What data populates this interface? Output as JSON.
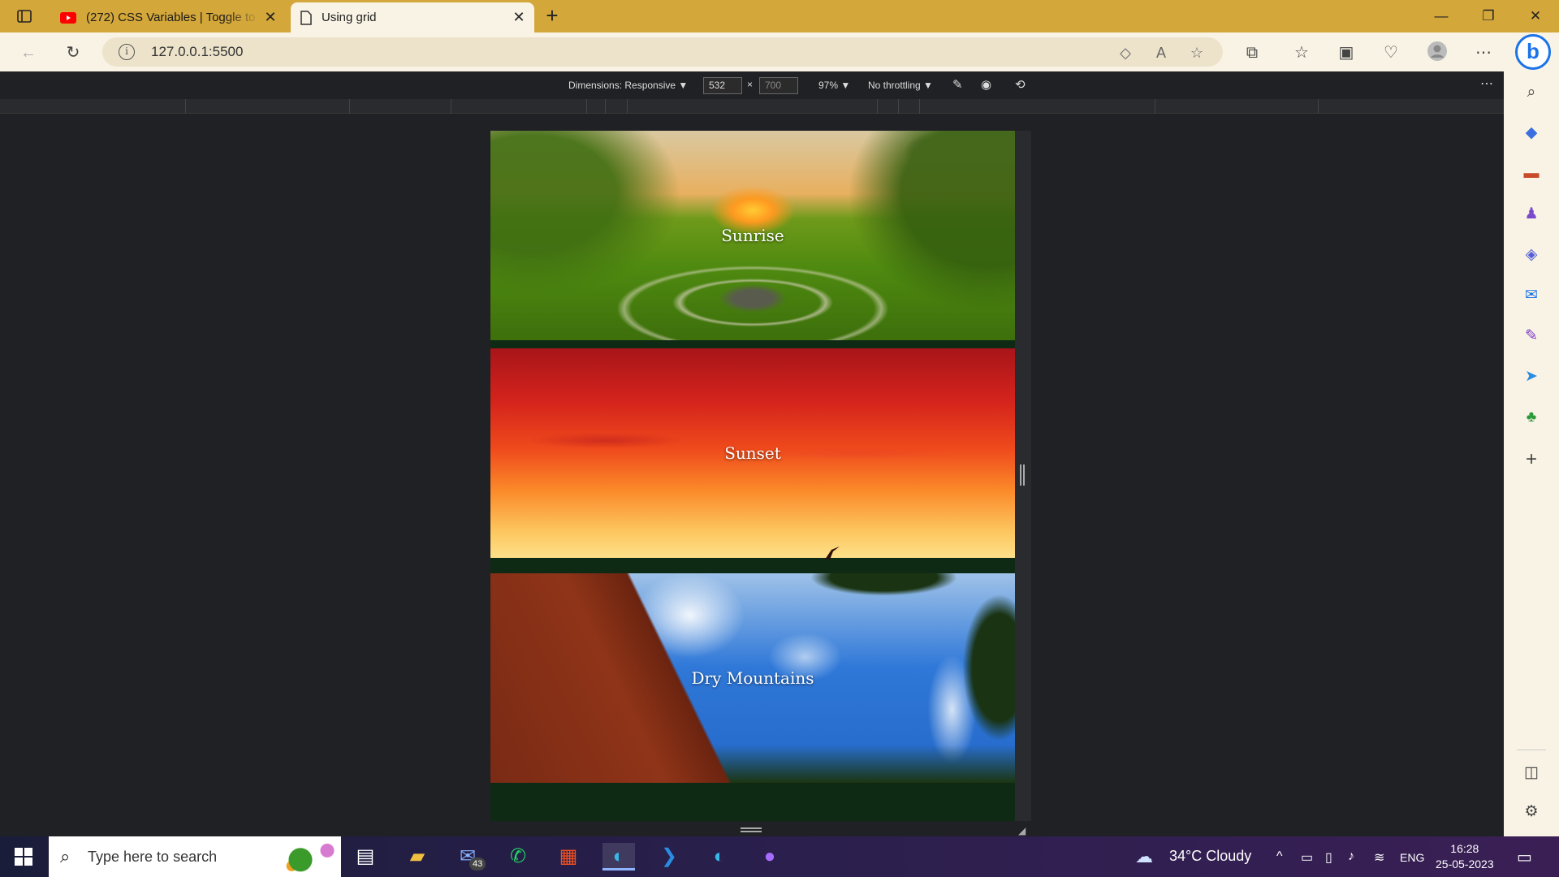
{
  "browser": {
    "tabs": [
      {
        "title": "(272) CSS Variables | Toggle to th",
        "favicon": "youtube-icon",
        "active": false
      },
      {
        "title": "Using grid",
        "favicon": "document-icon",
        "active": true
      }
    ],
    "url": "127.0.0.1:5500"
  },
  "devtools": {
    "dimensions_label": "Dimensions: Responsive",
    "width": "532",
    "height": "700",
    "zoom": "97%",
    "throttling": "No throttling",
    "times": "×"
  },
  "page": {
    "cards": [
      {
        "label": "Sunrise"
      },
      {
        "label": "Sunset"
      },
      {
        "label": "Dry Mountains"
      }
    ]
  },
  "taskbar": {
    "search_placeholder": "Type here to search",
    "mail_badge": "43",
    "weather": "34°C  Cloudy",
    "language": "ENG",
    "time": "16:28",
    "date": "25-05-2023"
  },
  "colors": {
    "tabstrip": "#d4a73a",
    "toolbar": "#f9f3e5",
    "devtools_bg": "#202124",
    "accent": "#1a73e8"
  }
}
